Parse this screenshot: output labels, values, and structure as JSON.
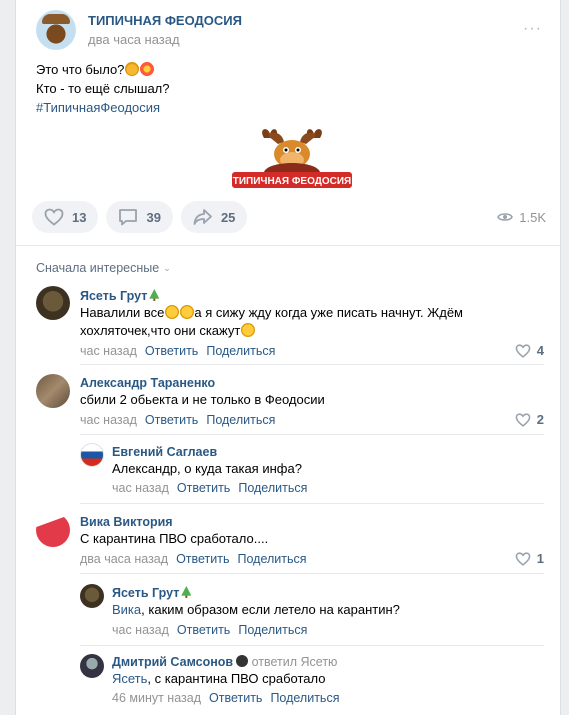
{
  "post": {
    "group_name": "ТИПИЧНАЯ ФЕОДОСИЯ",
    "time": "два часа назад",
    "more": "···",
    "text_line1": "Это что было?",
    "text_line2": "Кто - то ещё слышал?",
    "hashtag": "#ТипичнаяФеодосия",
    "logo_text": "ТИПИЧНАЯ ФЕОДОСИЯ",
    "likes": "13",
    "comments": "39",
    "shares": "25",
    "views": "1.5K"
  },
  "comments_section": {
    "sort_label": "Сначала интересные",
    "items": [
      {
        "author": "Ясеть Грут",
        "text_line1_a": "Навалили все",
        "text_line1_b": "а я сижу жду когда уже писать начнут. Ждём",
        "text_line2": "хохляточек,что они скажут",
        "time": "час назад",
        "reply": "Ответить",
        "share": "Поделиться",
        "likes": "4"
      },
      {
        "author": "Александр Тараненко",
        "text": "сбили 2 обьекта и не только в Феодосии",
        "time": "час назад",
        "reply": "Ответить",
        "share": "Поделиться",
        "likes": "2"
      },
      {
        "author": "Евгений Саглаев",
        "text": "Александр, о куда такая инфа?",
        "time": "час назад",
        "reply": "Ответить",
        "share": "Поделиться"
      },
      {
        "author": "Вика Виктория",
        "text": "С карантина ПВО сработало....",
        "time": "два часа назад",
        "reply": "Ответить",
        "share": "Поделиться",
        "likes": "1"
      },
      {
        "author": "Ясеть Грут",
        "text_link": "Вика",
        "text_rest": ", каким образом если летело на карантин?",
        "time": "час назад",
        "reply": "Ответить",
        "share": "Поделиться"
      },
      {
        "author": "Дмитрий Самсонов",
        "replied_to": "ответил Ясетю",
        "text_link": "Ясеть",
        "text_rest": ", с карантина ПВО сработало",
        "time": "46 минут назад",
        "reply": "Ответить",
        "share": "Поделиться"
      }
    ]
  },
  "colors": {
    "link": "#2a5885",
    "muted": "#939393",
    "button_bg": "#f0f2f5",
    "logo_red": "#d32b27"
  }
}
